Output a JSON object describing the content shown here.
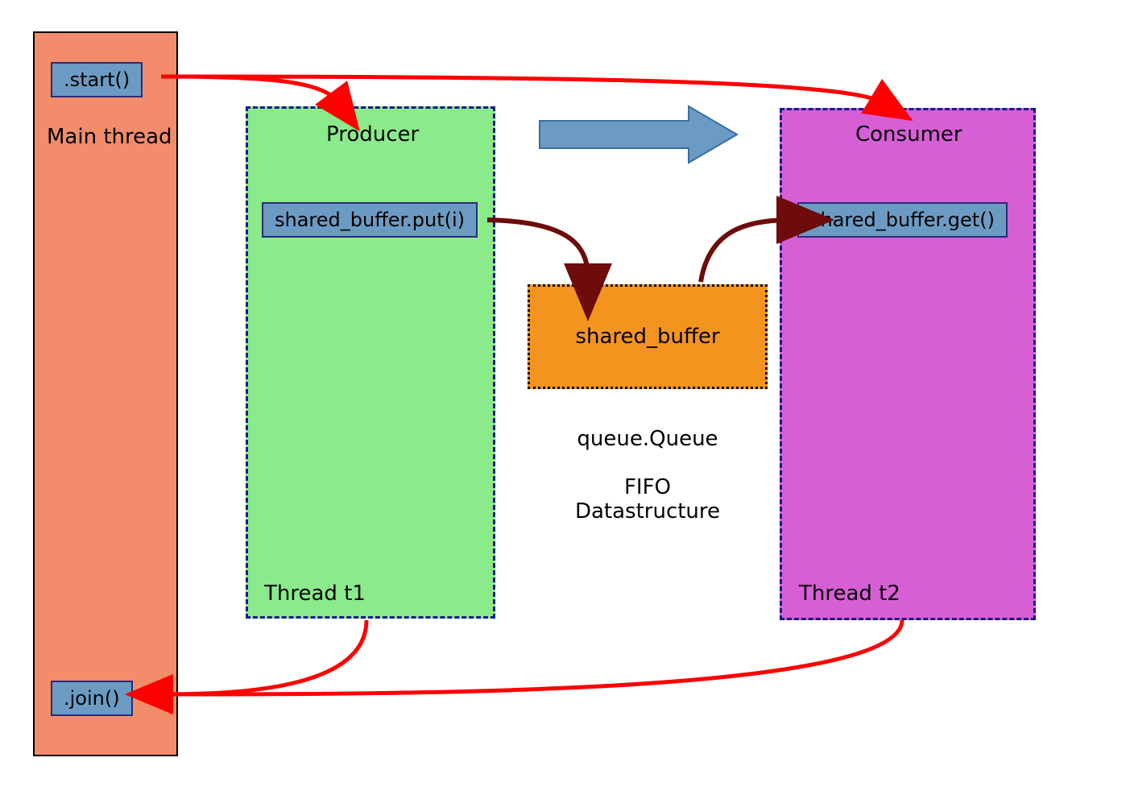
{
  "main": {
    "title": "Main thread",
    "start_label": ".start()",
    "join_label": ".join()"
  },
  "producer": {
    "title": "Producer",
    "thread_label": "Thread t1",
    "put_label": "shared_buffer.put(i)"
  },
  "consumer": {
    "title": "Consumer",
    "thread_label": "Thread t2",
    "get_label": "shared_buffer.get()"
  },
  "shared": {
    "box_label": "shared_buffer",
    "queue_label": "queue.Queue",
    "fifo_line1": "FIFO",
    "fifo_line2": "Datastructure"
  },
  "colors": {
    "main_bg": "#f28c6a",
    "producer_bg": "#8bea8b",
    "consumer_bg": "#d65fd6",
    "shared_bg": "#f3941e",
    "chip_bg": "#6b9bc3",
    "chip_border": "#2b2b7a",
    "red_arrow": "#ff0000",
    "dark_red_arrow": "#6e0b0b",
    "blue_arrow": "#6b9bc3"
  }
}
